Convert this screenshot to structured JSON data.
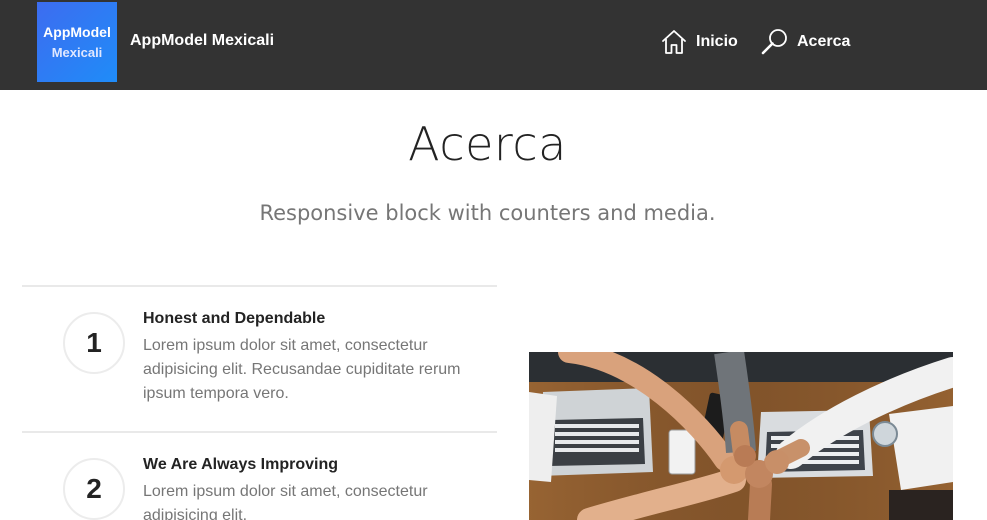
{
  "navbar": {
    "logo_line1": "AppModel",
    "logo_line2": "Mexicali",
    "brand": "AppModel Mexicali",
    "links": [
      {
        "label": "Inicio",
        "icon": "home-icon"
      },
      {
        "label": "Acerca",
        "icon": "search-icon"
      }
    ]
  },
  "header": {
    "title": "Acerca",
    "subtitle": "Responsive block with counters and media."
  },
  "features": [
    {
      "number": "1",
      "title": "Honest and Dependable",
      "text": "Lorem ipsum dolor sit amet, consectetur adipisicing elit. Recusandae cupiditate rerum ipsum tempora vero."
    },
    {
      "number": "2",
      "title": "We Are Always Improving",
      "text": "Lorem ipsum dolor sit amet, consectetur adipisicing elit."
    }
  ],
  "colors": {
    "navbar_bg": "#333333",
    "logo_gradient_start": "#3d6cf0",
    "logo_gradient_end": "#1f8cf8",
    "muted_text": "#767676"
  }
}
